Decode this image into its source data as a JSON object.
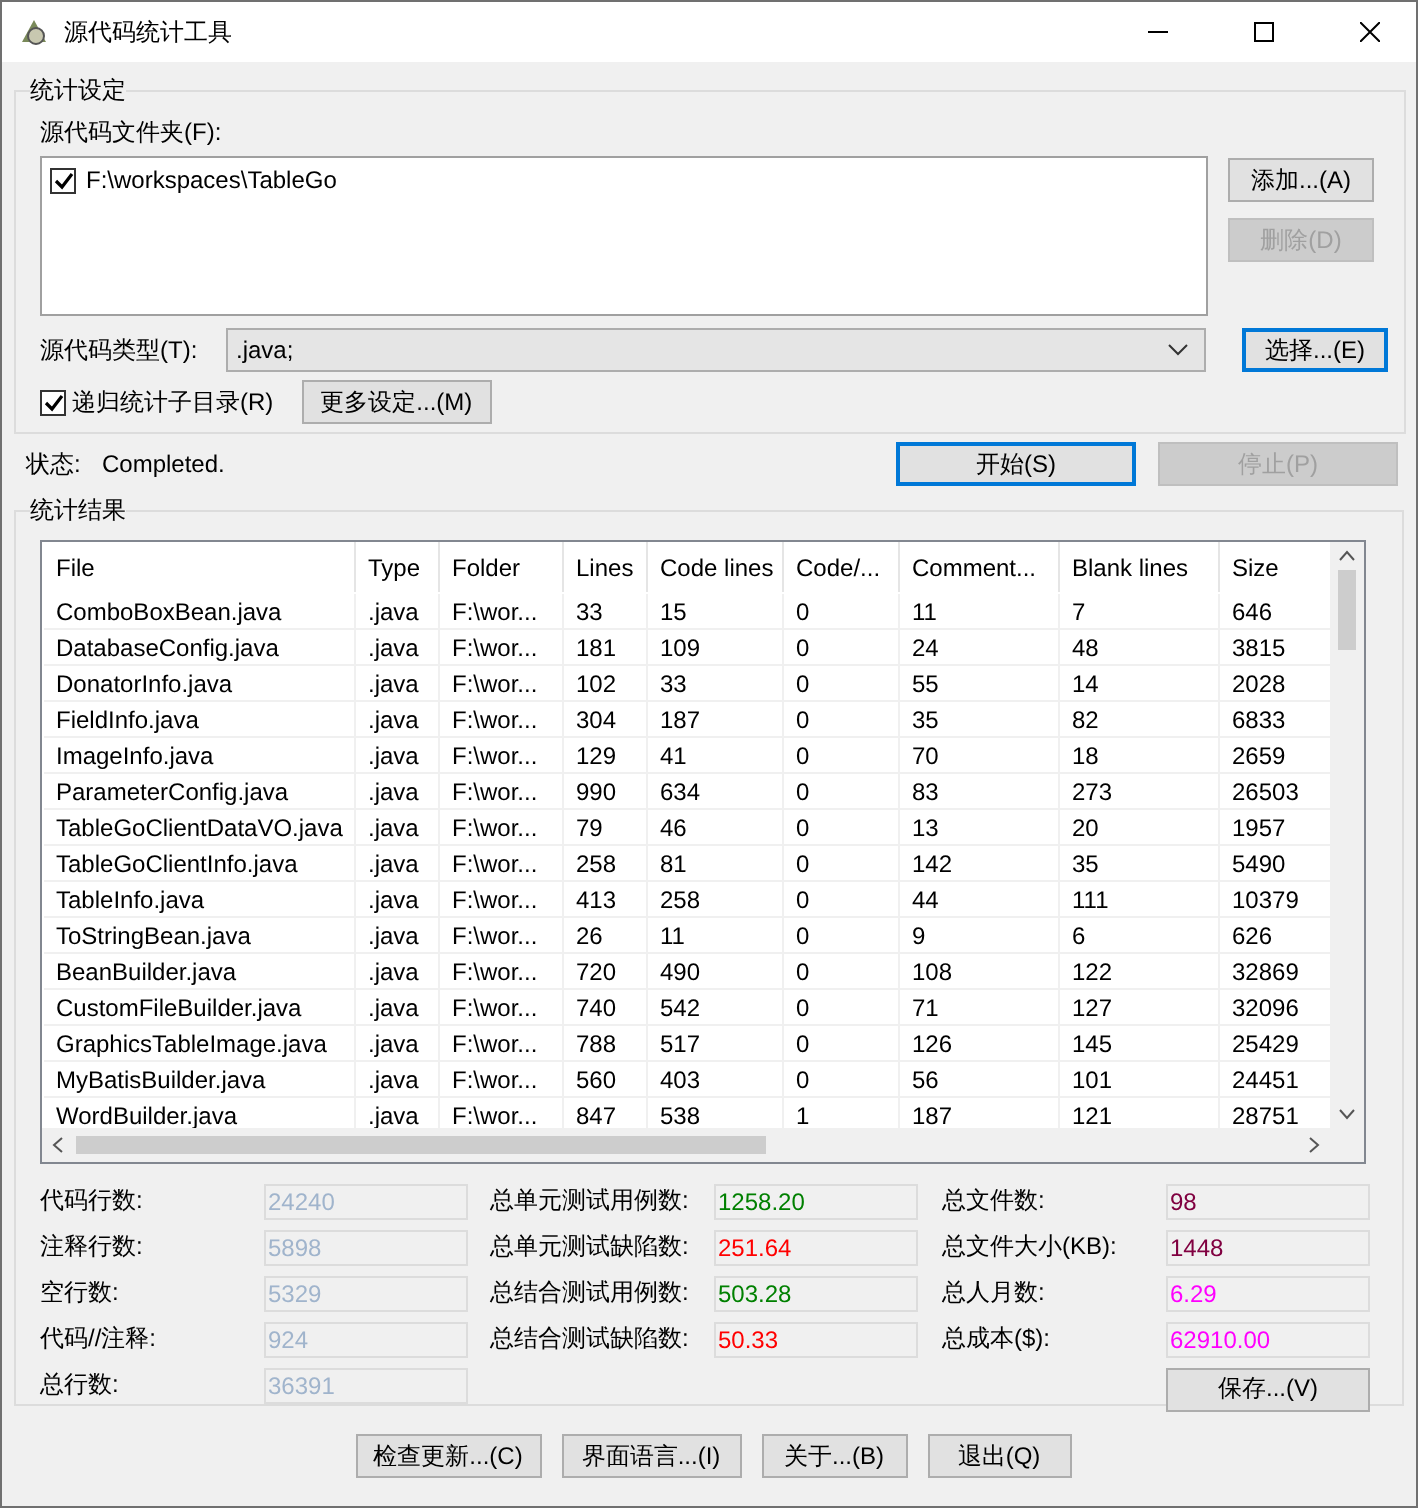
{
  "window": {
    "title": "源代码统计工具"
  },
  "settings": {
    "title": "统计设定",
    "folder_label": "源代码文件夹(F):",
    "folders": [
      {
        "path": "F:\\workspaces\\TableGo",
        "checked": true
      }
    ],
    "folder_buttons": [
      {
        "label": "添加...(A)",
        "disabled": false,
        "focused": false
      },
      {
        "label": "删除(D)",
        "disabled": true,
        "focused": false
      }
    ],
    "type_label": "源代码类型(T):",
    "type_value": ".java;",
    "type_button": {
      "label": "选择...(E)",
      "disabled": false,
      "focused": true
    },
    "recursive": {
      "label": "递归统计子目录(R)",
      "checked": true
    },
    "more_button": {
      "label": "更多设定...(M)",
      "disabled": false,
      "focused": false
    }
  },
  "status": {
    "label": "状态:",
    "value": "Completed."
  },
  "run_buttons": [
    {
      "label": "开始(S)",
      "disabled": false,
      "focused": true
    },
    {
      "label": "停止(P)",
      "disabled": true,
      "focused": false
    }
  ],
  "results": {
    "title": "统计结果",
    "table": {
      "columns": [
        "File",
        "Type",
        "Folder",
        "Lines",
        "Code lines",
        "Code/...",
        "Comment...",
        "Blank lines",
        "Size"
      ],
      "rows": [
        [
          "ComboBoxBean.java",
          ".java",
          "F:\\wor...",
          "33",
          "15",
          "0",
          "11",
          "7",
          "646"
        ],
        [
          "DatabaseConfig.java",
          ".java",
          "F:\\wor...",
          "181",
          "109",
          "0",
          "24",
          "48",
          "3815"
        ],
        [
          "DonatorInfo.java",
          ".java",
          "F:\\wor...",
          "102",
          "33",
          "0",
          "55",
          "14",
          "2028"
        ],
        [
          "FieldInfo.java",
          ".java",
          "F:\\wor...",
          "304",
          "187",
          "0",
          "35",
          "82",
          "6833"
        ],
        [
          "ImageInfo.java",
          ".java",
          "F:\\wor...",
          "129",
          "41",
          "0",
          "70",
          "18",
          "2659"
        ],
        [
          "ParameterConfig.java",
          ".java",
          "F:\\wor...",
          "990",
          "634",
          "0",
          "83",
          "273",
          "26503"
        ],
        [
          "TableGoClientDataVO.java",
          ".java",
          "F:\\wor...",
          "79",
          "46",
          "0",
          "13",
          "20",
          "1957"
        ],
        [
          "TableGoClientInfo.java",
          ".java",
          "F:\\wor...",
          "258",
          "81",
          "0",
          "142",
          "35",
          "5490"
        ],
        [
          "TableInfo.java",
          ".java",
          "F:\\wor...",
          "413",
          "258",
          "0",
          "44",
          "111",
          "10379"
        ],
        [
          "ToStringBean.java",
          ".java",
          "F:\\wor...",
          "26",
          "11",
          "0",
          "9",
          "6",
          "626"
        ],
        [
          "BeanBuilder.java",
          ".java",
          "F:\\wor...",
          "720",
          "490",
          "0",
          "108",
          "122",
          "32869"
        ],
        [
          "CustomFileBuilder.java",
          ".java",
          "F:\\wor...",
          "740",
          "542",
          "0",
          "71",
          "127",
          "32096"
        ],
        [
          "GraphicsTableImage.java",
          ".java",
          "F:\\wor...",
          "788",
          "517",
          "0",
          "126",
          "145",
          "25429"
        ],
        [
          "MyBatisBuilder.java",
          ".java",
          "F:\\wor...",
          "560",
          "403",
          "0",
          "56",
          "101",
          "24451"
        ],
        [
          "WordBuilder.java",
          ".java",
          "F:\\wor...",
          "847",
          "538",
          "1",
          "187",
          "121",
          "28751"
        ]
      ]
    },
    "stats": [
      [
        {
          "label": "代码行数:",
          "value": "24240",
          "color": "#a0b4cc"
        },
        {
          "label": "注释行数:",
          "value": "5898",
          "color": "#a0b4cc"
        },
        {
          "label": "空行数:",
          "value": "5329",
          "color": "#a0b4cc"
        },
        {
          "label": "代码//注释:",
          "value": "924",
          "color": "#a0b4cc"
        },
        {
          "label": "总行数:",
          "value": "36391",
          "color": "#a0b4cc"
        }
      ],
      [
        {
          "label": "总单元测试用例数:",
          "value": "1258.20",
          "color": "#008000"
        },
        {
          "label": "总单元测试缺陷数:",
          "value": "251.64",
          "color": "#ff0000"
        },
        {
          "label": "总结合测试用例数:",
          "value": "503.28",
          "color": "#008000"
        },
        {
          "label": "总结合测试缺陷数:",
          "value": "50.33",
          "color": "#ff0000"
        }
      ],
      [
        {
          "label": "总文件数:",
          "value": "98",
          "color": "#800040"
        },
        {
          "label": "总文件大小(KB):",
          "value": "1448",
          "color": "#800040"
        },
        {
          "label": "总人月数:",
          "value": "6.29",
          "color": "#ff00ff"
        },
        {
          "label": "总成本($):",
          "value": "62910.00",
          "color": "#ff00ff"
        }
      ]
    ],
    "save_button": {
      "label": "保存...(V)",
      "disabled": false,
      "focused": false
    }
  },
  "footer_buttons": [
    {
      "label": "检查更新...(C)",
      "disabled": false,
      "focused": false
    },
    {
      "label": "界面语言...(I)",
      "disabled": false,
      "focused": false
    },
    {
      "label": "关于...(B)",
      "disabled": false,
      "focused": false
    },
    {
      "label": "退出(Q)",
      "disabled": false,
      "focused": false
    }
  ]
}
